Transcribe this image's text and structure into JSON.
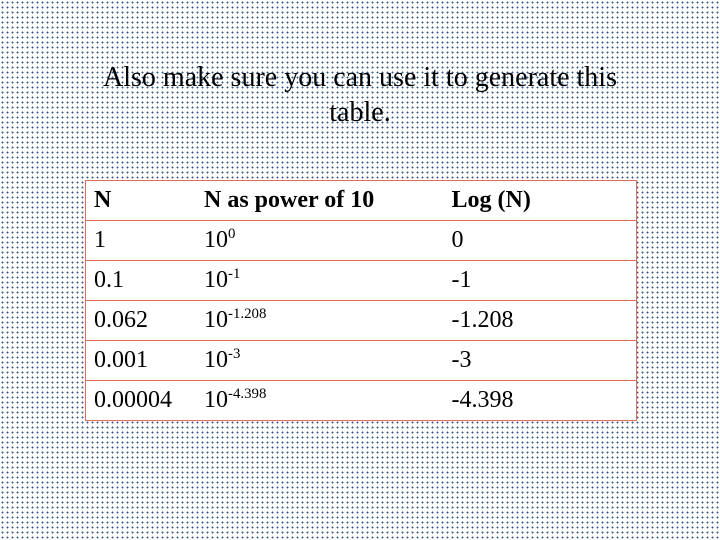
{
  "caption_line1": "Also make sure you can use it to generate this",
  "caption_line2": "table.",
  "headers": {
    "n": "N",
    "p": "N as power of 10",
    "l": "Log (N)"
  },
  "rows": [
    {
      "n": "1",
      "base": "10",
      "exp": "0",
      "log": "0"
    },
    {
      "n": "0.1",
      "base": "10",
      "exp": "-1",
      "log": "-1"
    },
    {
      "n": "0.062",
      "base": "10",
      "exp": "-1.208",
      "log": "-1.208"
    },
    {
      "n": "0.001",
      "base": "10",
      "exp": "-3",
      "log": "-3"
    },
    {
      "n": "0.00004",
      "base": "10",
      "exp": "-4.398",
      "log": "-4.398"
    }
  ],
  "chart_data": {
    "type": "table",
    "title": "Also make sure you can use it to generate this table.",
    "columns": [
      "N",
      "N as power of 10",
      "Log (N)"
    ],
    "rows": [
      [
        "1",
        "10^0",
        "0"
      ],
      [
        "0.1",
        "10^-1",
        "-1"
      ],
      [
        "0.062",
        "10^-1.208",
        "-1.208"
      ],
      [
        "0.001",
        "10^-3",
        "-3"
      ],
      [
        "0.00004",
        "10^-4.398",
        "-4.398"
      ]
    ]
  }
}
